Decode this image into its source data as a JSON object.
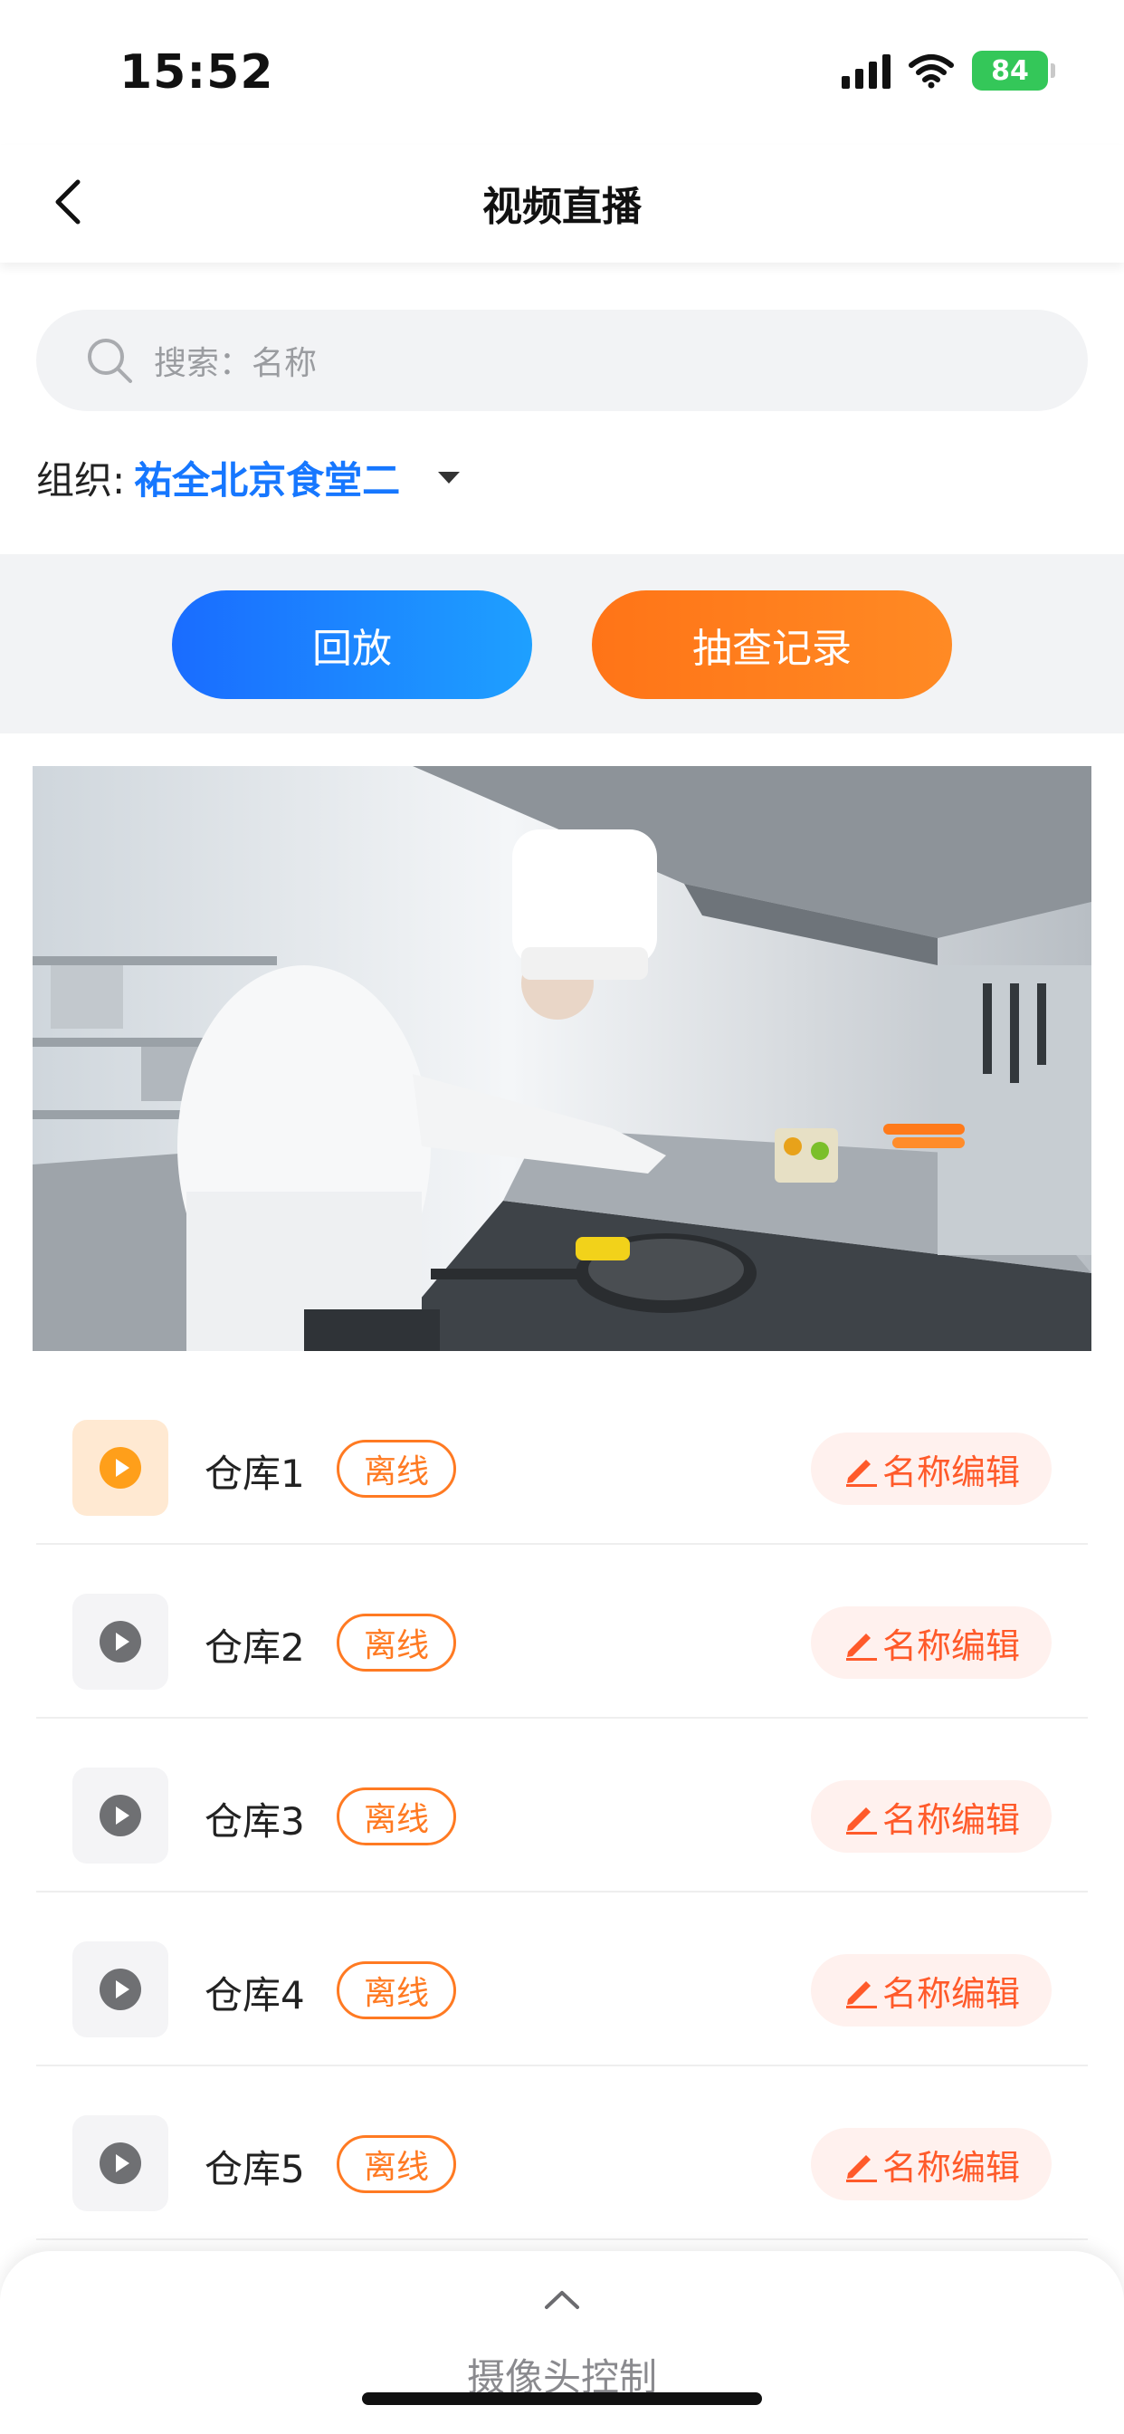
{
  "status_bar": {
    "time": "15:52",
    "battery": "84"
  },
  "header": {
    "title": "视频直播"
  },
  "search": {
    "placeholder": "搜索：名称"
  },
  "organization": {
    "label": "组织:",
    "value": "祐全北京食堂二"
  },
  "actions": {
    "replay_label": "回放",
    "check_label": "抽查记录"
  },
  "cameras": [
    {
      "name": "仓库1",
      "status": "离线",
      "edit_label": "名称编辑",
      "active": true
    },
    {
      "name": "仓库2",
      "status": "离线",
      "edit_label": "名称编辑",
      "active": false
    },
    {
      "name": "仓库3",
      "status": "离线",
      "edit_label": "名称编辑",
      "active": false
    },
    {
      "name": "仓库4",
      "status": "离线",
      "edit_label": "名称编辑",
      "active": false
    },
    {
      "name": "仓库5",
      "status": "离线",
      "edit_label": "名称编辑",
      "active": false
    }
  ],
  "bottom_sheet": {
    "label": "摄像头控制"
  },
  "colors": {
    "primary_blue": "#1677ff",
    "accent_orange": "#ff7a22",
    "battery_green": "#34c759"
  }
}
